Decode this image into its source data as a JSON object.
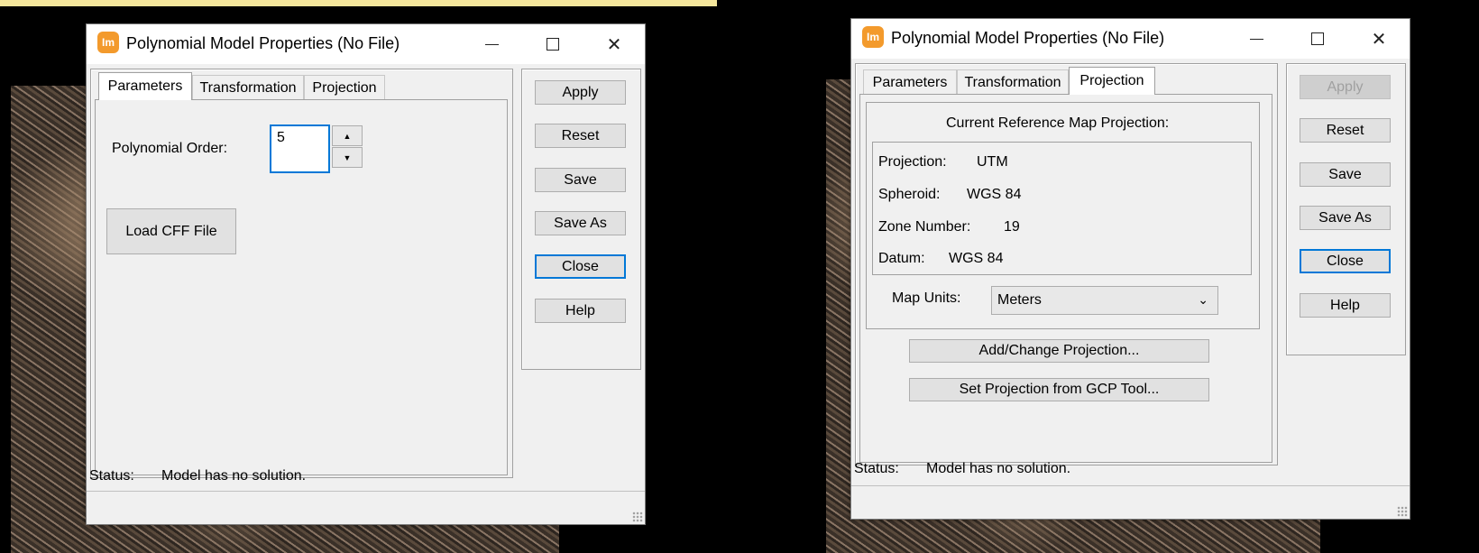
{
  "window_left": {
    "app_icon_text": "Im",
    "title": "Polynomial Model Properties (No File)",
    "tabs": [
      "Parameters",
      "Transformation",
      "Projection"
    ],
    "active_tab": "Parameters",
    "polynomial_order_label": "Polynomial Order:",
    "polynomial_order_value": "5",
    "load_cff_label": "Load CFF File",
    "buttons": {
      "apply": "Apply",
      "reset": "Reset",
      "save": "Save",
      "save_as": "Save As",
      "close": "Close",
      "help": "Help"
    },
    "status_label": "Status:",
    "status_text": "Model has no solution."
  },
  "window_right": {
    "app_icon_text": "Im",
    "title": "Polynomial Model Properties (No File)",
    "tabs": [
      "Parameters",
      "Transformation",
      "Projection"
    ],
    "active_tab": "Projection",
    "group_title": "Current Reference Map Projection:",
    "projection_label": "Projection:",
    "projection_value": "UTM",
    "spheroid_label": "Spheroid:",
    "spheroid_value": "WGS 84",
    "zone_label": "Zone Number:",
    "zone_value": "19",
    "datum_label": "Datum:",
    "datum_value": "WGS 84",
    "map_units_label": "Map Units:",
    "map_units_value": "Meters",
    "add_change_label": "Add/Change Projection...",
    "set_from_gcp_label": "Set Projection from GCP Tool...",
    "buttons": {
      "apply": "Apply",
      "reset": "Reset",
      "save": "Save",
      "save_as": "Save As",
      "close": "Close",
      "help": "Help"
    },
    "apply_disabled": true,
    "status_label": "Status:",
    "status_text": "Model has no solution."
  },
  "icons": {
    "window_min": "minimize-icon",
    "window_max": "maximize-icon",
    "window_close": "close-icon",
    "spin_up": "arrow-up-icon",
    "spin_down": "arrow-down-icon",
    "dropdown": "chevron-down-icon"
  },
  "colors": {
    "accent": "#0078d7",
    "app_icon": "#f39a2c",
    "highlight_strip": "#f4e69c"
  }
}
